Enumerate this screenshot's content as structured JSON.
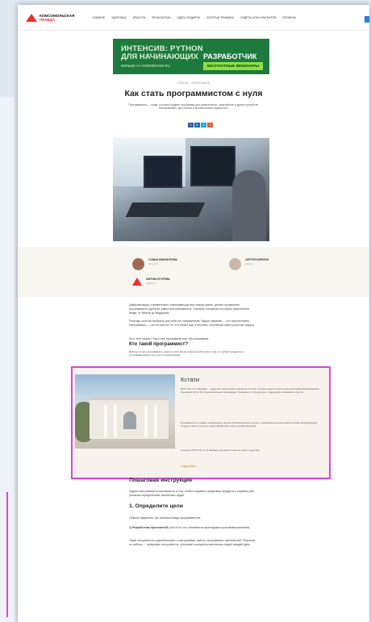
{
  "header": {
    "logo_line1": "КОМСОМОЛЬСКАЯ",
    "logo_line2": "ПРАВДА",
    "nav": [
      "ГЛАВНОЕ",
      "ЗДОРОВЬЕ",
      "КРАСОТА",
      "ТЕХНОЛОГИИ",
      "ЗДЕСЬ ПОДАРОК",
      "ЗОЛОТЫЕ ПРАВИЛА",
      "СОВЕТЫ КОНСУЛЬТАНТОВ",
      "ПРОФИЛЬ"
    ]
  },
  "banner": {
    "line1": "ИНТЕНСИВ: PYTHON",
    "line2": "ДЛЯ НАЧИНАЮЩИХ",
    "line3": "РАЗРАБОТЧИК",
    "geek": "БОЛЬШЕ НА GEEKBRAINS.RU",
    "button": "БЕСПЛАТНЫЕ ВЕБИНАРЫ"
  },
  "article": {
    "breadcrumb": "ГЛАВНАЯ  ·  ОБРАЗОВАНИЕ",
    "title": "Как стать программистом с нуля",
    "lead": "Программисты — люди, которые создают программы для компьютеров, смартфонов и других устройств. Рассказываем, где учиться и сколько можно заработать.",
    "share": [
      "f",
      "in",
      "t",
      "v"
    ],
    "authors": [
      {
        "name": "СОФЬЯ НИКИФОРОВА",
        "role": "автор КП"
      },
      {
        "name": "СЕРГЕЙ КАРЕЛИН",
        "role": "эксперт"
      },
      {
        "name": "ЗАРИНА ЕГОРОВА",
        "role": "редактор"
      }
    ],
    "p1": "Цифровизация, стремительно охватывающая все сферы жизни, делает профессию программиста одной из самых востребованных. Хорошие специалисты нужны практически везде: от банков до медицины.",
    "p2": "Поэтому, если вы выбрали для себя это направление, будьте уверены — это перспективно. Программист — это не просто тот, кто пишет код, а человек, способный найти решение задачи.",
    "p3": "Но с чего начать? Как стать программистом? Мы расскажем.",
    "h_who": "Кто такой программист?",
    "p4": "Вообще слово «программист» само по себе звучит довольно абстрактно. Как и в любой профессии, в программировании есть свои специализации.",
    "kstati_title": "Кстати",
    "kstati_p1": "МГТУ им. Н. Э. Баумана — ведущий технический университет России. Сегодня ведётся подготовка высококвалифицированных специалистов по 18 образовательным программам. Университет сотрудничает с ведущими компаниями отрасли.",
    "kstati_p2": "В университете созданы современные научно-образовательные центры, оснащённые высокотехнологичным оборудованием. Студенты могут получать практический опыт ещё во время обучения.",
    "kstati_p3": "Сегодня в МГТУ им. Н. Э. Баумана обучается более 19 тысяч студентов.",
    "kstati_more": "Подробнее  →",
    "h_steps": "Пошаговая инструкция",
    "p5": "Задача программиста заключается в том, чтобы создавать цифровые продукты и сервисы для решения определённых жизненных задач.",
    "h_step1": "1. Определите цели",
    "p6": "Обычно выделяют три основных вида программистов:",
    "p7_bold": "1) Разработчик приложений",
    "p7": " (почти тот, кто занимается прикладным программированием).",
    "p8": "Такие специалисты разрабатывают и настраивают работу программных приложений. Результат их работы — цифровые инструменты, которыми пользуются миллионы людей каждый день."
  }
}
